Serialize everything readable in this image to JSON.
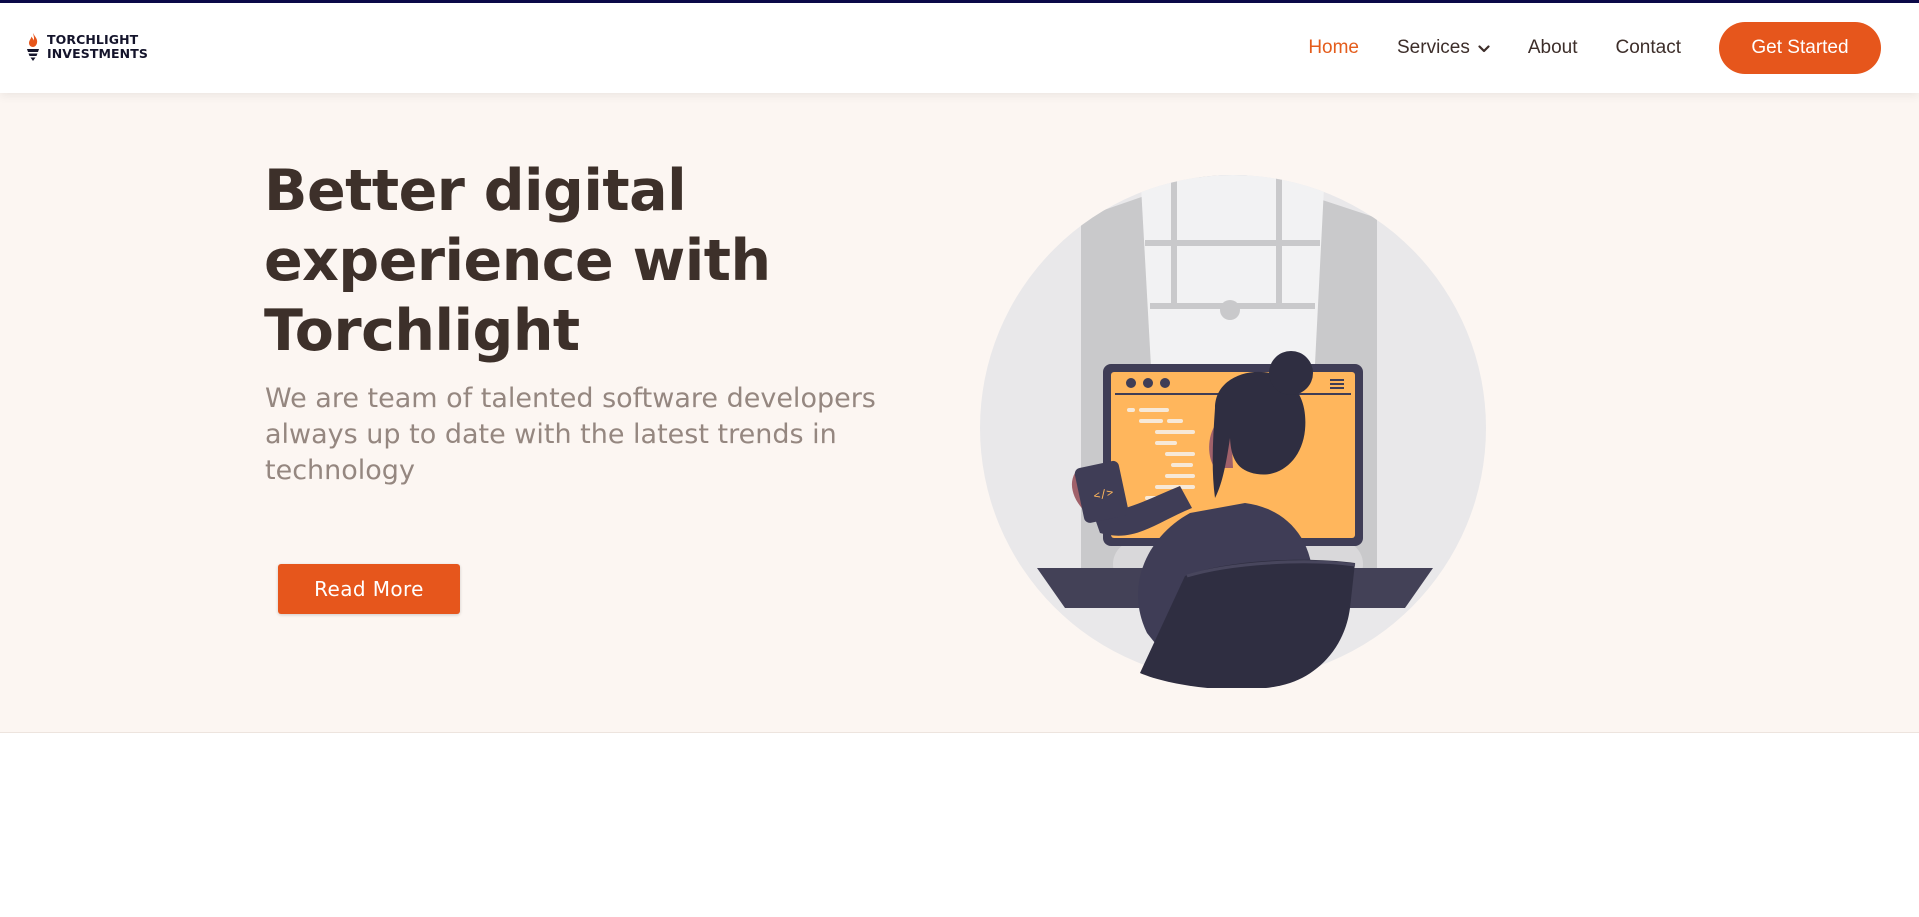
{
  "brand": {
    "line1": "TORCHLIGHT",
    "line2": "INVESTMENTS",
    "accent": "#e6561c",
    "dark": "#14142b"
  },
  "nav": {
    "home": "Home",
    "services": "Services",
    "about": "About",
    "contact": "Contact",
    "cta": "Get Started",
    "active": "Home"
  },
  "hero": {
    "title_line1": "Better digital",
    "title_line2": "experience with",
    "title_line3": "Torchlight",
    "subtitle": "We are team of talented software developers always up to date with the latest trends in technology",
    "button": "Read More",
    "background": "#fcf6f2"
  },
  "illustration": {
    "code_tag": "</>",
    "icon": "developer-at-desk-illustration"
  }
}
